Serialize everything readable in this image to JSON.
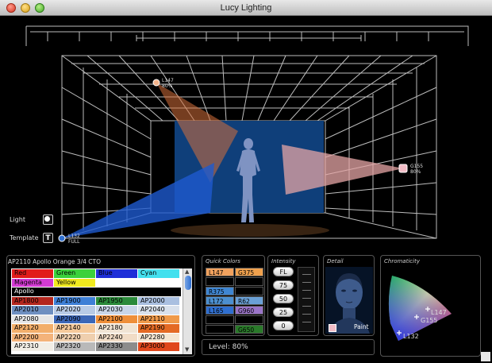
{
  "window": {
    "title": "Lucy Lighting"
  },
  "stage": {
    "lights": [
      {
        "id": "L147",
        "level": "80%"
      },
      {
        "id": "G155",
        "level": "80%"
      },
      {
        "id": "L132",
        "level": "FULL"
      }
    ],
    "controls": {
      "light_label": "Light",
      "template_label": "Template",
      "template_icon_text": "T"
    }
  },
  "gel_picker": {
    "header": "AP2110  Apollo Orange 3/4 CTO",
    "basic": [
      {
        "name": "Red",
        "color": "#e11b1b",
        "text": "#000"
      },
      {
        "name": "Green",
        "color": "#3bd13b",
        "text": "#000"
      },
      {
        "name": "Blue",
        "color": "#1f2fd8",
        "text": "#000"
      },
      {
        "name": "Cyan",
        "color": "#43e0ee",
        "text": "#000"
      },
      {
        "name": "Magenta",
        "color": "#d33ad3",
        "text": "#000"
      },
      {
        "name": "Yellow",
        "color": "#f0ea1e",
        "text": "#000"
      }
    ],
    "apollo_label": "Apollo",
    "rows": [
      [
        {
          "name": "AP1800",
          "color": "#b3261e"
        },
        {
          "name": "AP1900",
          "color": "#3d7fd6"
        },
        {
          "name": "AP1950",
          "color": "#2a8a3a"
        },
        {
          "name": "AP2000",
          "color": "#a9bfe0"
        }
      ],
      [
        {
          "name": "AP2010",
          "color": "#6e8fc0"
        },
        {
          "name": "AP2020",
          "color": "#b8cbe6"
        },
        {
          "name": "AP2030",
          "color": "#c9d6e8"
        },
        {
          "name": "AP2040",
          "color": "#d9e1ec"
        }
      ],
      [
        {
          "name": "AP2080",
          "color": "#e6e6e6"
        },
        {
          "name": "AP2090",
          "color": "#3c67b7"
        },
        {
          "name": "AP2100",
          "color": "#ee8f3a"
        },
        {
          "name": "AP2110",
          "color": "#f09a4a"
        }
      ],
      [
        {
          "name": "AP2120",
          "color": "#f2ae6a"
        },
        {
          "name": "AP2140",
          "color": "#f5c99a"
        },
        {
          "name": "AP2180",
          "color": "#f0e4d4"
        },
        {
          "name": "AP2190",
          "color": "#e46a24"
        }
      ],
      [
        {
          "name": "AP2200",
          "color": "#f4b37a"
        },
        {
          "name": "AP2220",
          "color": "#efcfae"
        },
        {
          "name": "AP2240",
          "color": "#f1dcc6"
        },
        {
          "name": "AP2280",
          "color": "#f5e6d2"
        }
      ],
      [
        {
          "name": "AP2310",
          "color": "#f2eee6"
        },
        {
          "name": "AP2320",
          "color": "#b9b9b9"
        },
        {
          "name": "AP2330",
          "color": "#8c8c8c"
        },
        {
          "name": "AP3000",
          "color": "#e0471c"
        }
      ]
    ]
  },
  "quick_colors": {
    "title": "Quick Colors",
    "rows": [
      [
        {
          "name": "L147",
          "color": "#f2a25e"
        },
        {
          "name": "G375",
          "color": "#f0a14d"
        }
      ],
      [
        {
          "name": "",
          "color": "#000000"
        },
        {
          "name": "",
          "color": "#000000"
        }
      ],
      [
        {
          "name": "R375",
          "color": "#3f86d2"
        },
        {
          "name": "",
          "color": "#000000"
        }
      ],
      [
        {
          "name": "L172",
          "color": "#4c8fcf"
        },
        {
          "name": "R62",
          "color": "#6aa0d6"
        }
      ],
      [
        {
          "name": "L165",
          "color": "#2f6fd0"
        },
        {
          "name": "G960",
          "color": "#9a74c8"
        }
      ],
      [
        {
          "name": "",
          "color": "#000000"
        },
        {
          "name": "",
          "color": "#000000"
        }
      ],
      [
        {
          "name": "",
          "color": "#000000"
        },
        {
          "name": "G650",
          "color": "#2a7a2a"
        }
      ]
    ]
  },
  "intensity": {
    "title": "Intensity",
    "buttons": [
      "FL",
      "75",
      "50",
      "25",
      "0"
    ]
  },
  "detail": {
    "title": "Detail",
    "paint_label": "Paint"
  },
  "chromaticity": {
    "title": "Chromaticity",
    "points": [
      "L147",
      "G155",
      "L132"
    ]
  },
  "level": {
    "text": "Level: 80%"
  },
  "colors": {
    "beam_orange": "#d6703a",
    "beam_blue": "#1e5ad0",
    "beam_pink": "#e6a6a6",
    "wire": "#bdbdbd"
  }
}
